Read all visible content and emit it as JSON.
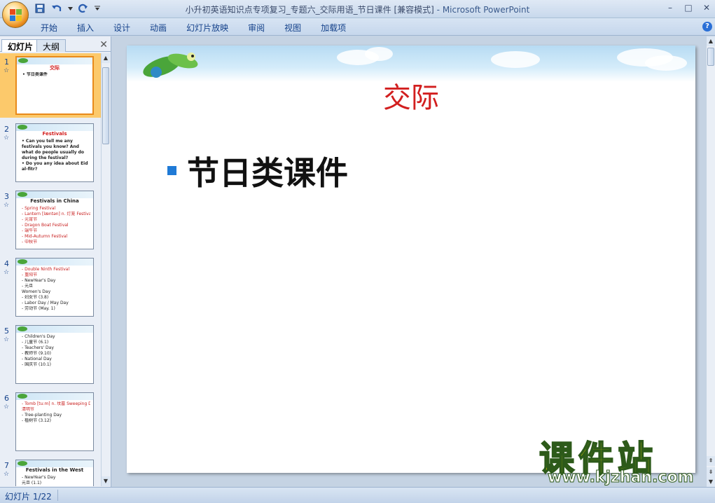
{
  "window": {
    "title": "小升初英语知识点专项复习_专题六_交际用语_节日课件 [兼容模式]",
    "app_name": "- Microsoft PowerPoint",
    "minimize": "–",
    "maximize": "□",
    "close": "✕"
  },
  "menu": [
    "开始",
    "插入",
    "设计",
    "动画",
    "幻灯片放映",
    "审阅",
    "视图",
    "加载项"
  ],
  "panel": {
    "tab_slides": "幻灯片",
    "tab_outline": "大纲",
    "close": "✕"
  },
  "thumbnails": [
    {
      "num": "1",
      "star": "☆",
      "title": "交际",
      "title_red": true,
      "lines": [
        {
          "t": "• 节日类课件",
          "bold": true
        }
      ]
    },
    {
      "num": "2",
      "star": "☆",
      "title": "Festivals",
      "title_red": true,
      "lines": [
        {
          "t": "• Can you tell me any",
          "bold": true
        },
        {
          "t": "  festivals you know? And",
          "bold": true
        },
        {
          "t": "  what do people usually do",
          "bold": true
        },
        {
          "t": "  during the festival?",
          "bold": true
        },
        {
          "t": "• Do you any idea about Eid",
          "bold": true
        },
        {
          "t": "  al-fitr?",
          "bold": true
        }
      ]
    },
    {
      "num": "3",
      "star": "☆",
      "title": "Festivals in China",
      "lines": [
        {
          "t": "- Spring  Festival",
          "red": true
        },
        {
          "t": "- Lantern [læntən]  n. 灯笼  Festival",
          "red": true
        },
        {
          "t": "-        元宵节",
          "red": true
        },
        {
          "t": "- Dragon Boat Festival",
          "red": true
        },
        {
          "t": "-          端午节",
          "red": true
        },
        {
          "t": "- Mid-Autumn  Festival",
          "red": true
        },
        {
          "t": "-          中秋节",
          "red": true
        }
      ]
    },
    {
      "num": "4",
      "star": "☆",
      "title": "",
      "lines": [
        {
          "t": "- Double  Ninth  Festival",
          "red": true
        },
        {
          "t": "-          重阳节",
          "red": true
        },
        {
          "t": "- NewYear's  Day"
        },
        {
          "t": "-          元旦"
        },
        {
          "t": "Women's  Day"
        },
        {
          "t": "-      妇女节 (3.8)"
        },
        {
          "t": "- Labor Day / May Day"
        },
        {
          "t": "-    劳动节 (May. 1)"
        }
      ]
    },
    {
      "num": "5",
      "star": "☆",
      "title": "",
      "lines": [
        {
          "t": ""
        },
        {
          "t": "- Children's  Day"
        },
        {
          "t": "-      儿童节 (6.1)"
        },
        {
          "t": "- Teachers'  Day"
        },
        {
          "t": "-    教师节 (9.10)"
        },
        {
          "t": "- National  Day"
        },
        {
          "t": "-    国庆节 (10.1)"
        }
      ]
    },
    {
      "num": "6",
      "star": "☆",
      "title": "",
      "lines": [
        {
          "t": "- Tomb  [tu:m]  n. 坟墓  Sweeping  Day",
          "red": true
        },
        {
          "t": "           清明节",
          "red": true
        },
        {
          "t": "- Tree-planting  Day"
        },
        {
          "t": "-     植树节  (3.12)"
        }
      ]
    },
    {
      "num": "7",
      "star": "☆",
      "title": "Festivals in the West",
      "lines": [
        {
          "t": "- NewYear's  Day"
        },
        {
          "t": "     元旦 (1.1)"
        }
      ]
    }
  ],
  "slide": {
    "title": "交际",
    "body": "节日类课件"
  },
  "watermark": {
    "cn": "课件站",
    "url": "www.kjzhan.com"
  },
  "status": {
    "slide_info": "幻灯片 1/22"
  },
  "colors": {
    "title_red": "#d21f1f",
    "bullet_blue": "#1f7ad6",
    "selection_orange": "#fcc96b"
  }
}
